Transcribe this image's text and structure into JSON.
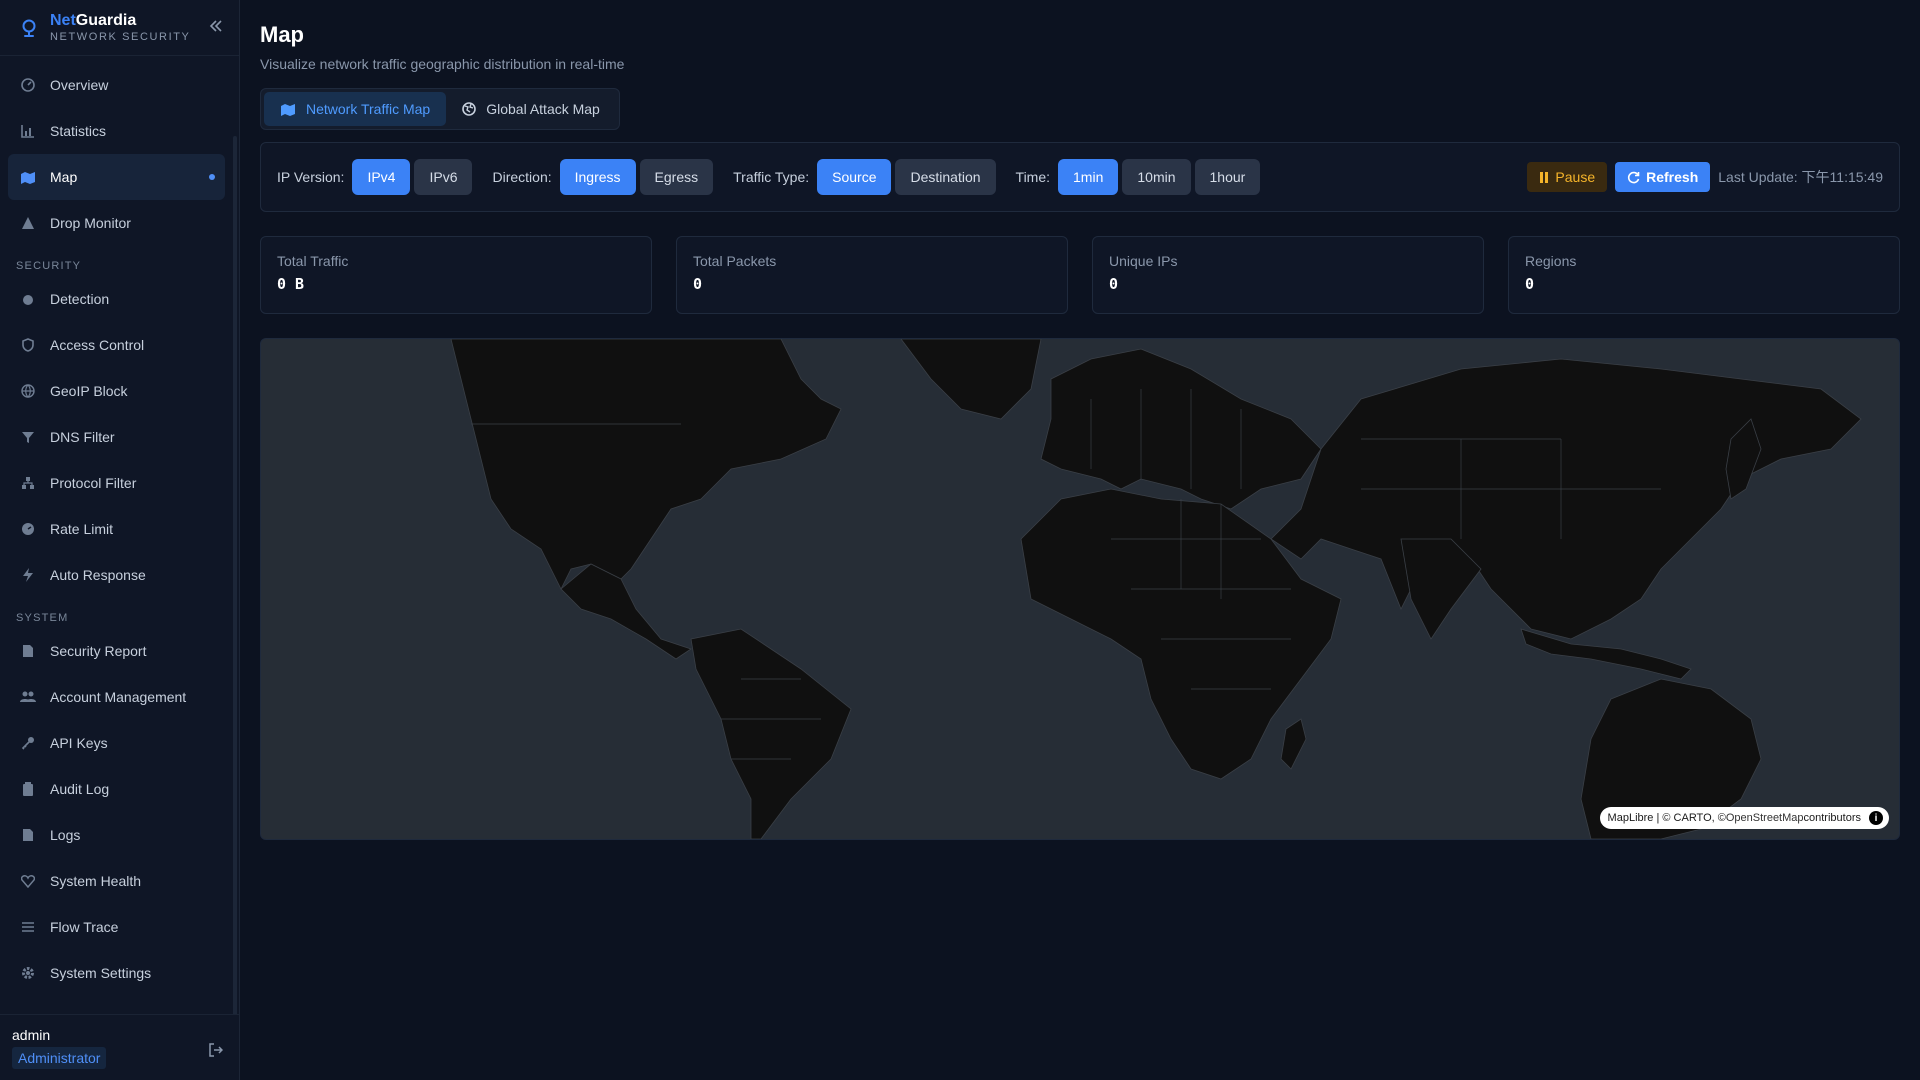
{
  "brand": {
    "name_part1": "Net",
    "name_part2": "Guardia",
    "subtitle": "NETWORK SECURITY"
  },
  "sidebar": {
    "main_items": [
      {
        "label": "Overview"
      },
      {
        "label": "Statistics"
      },
      {
        "label": "Map",
        "active": true
      },
      {
        "label": "Drop Monitor"
      }
    ],
    "security_label": "SECURITY",
    "security_items": [
      {
        "label": "Detection"
      },
      {
        "label": "Access Control"
      },
      {
        "label": "GeoIP Block"
      },
      {
        "label": "DNS Filter"
      },
      {
        "label": "Protocol Filter"
      },
      {
        "label": "Rate Limit"
      },
      {
        "label": "Auto Response"
      }
    ],
    "system_label": "SYSTEM",
    "system_items": [
      {
        "label": "Security Report"
      },
      {
        "label": "Account Management"
      },
      {
        "label": "API Keys"
      },
      {
        "label": "Audit Log"
      },
      {
        "label": "Logs"
      },
      {
        "label": "System Health"
      },
      {
        "label": "Flow Trace"
      },
      {
        "label": "System Settings"
      }
    ]
  },
  "user": {
    "name": "admin",
    "role": "Administrator"
  },
  "page": {
    "title": "Map",
    "subtitle": "Visualize network traffic geographic distribution in real-time",
    "tabs": [
      {
        "label": "Network Traffic Map",
        "active": true
      },
      {
        "label": "Global Attack Map",
        "active": false
      }
    ]
  },
  "filters": {
    "ip_version": {
      "label": "IP Version:",
      "options": [
        "IPv4",
        "IPv6"
      ],
      "selected": "IPv4"
    },
    "direction": {
      "label": "Direction:",
      "options": [
        "Ingress",
        "Egress"
      ],
      "selected": "Ingress"
    },
    "traffic_type": {
      "label": "Traffic Type:",
      "options": [
        "Source",
        "Destination"
      ],
      "selected": "Source"
    },
    "time": {
      "label": "Time:",
      "options": [
        "1min",
        "10min",
        "1hour"
      ],
      "selected": "1min"
    },
    "pause_label": "Pause",
    "refresh_label": "Refresh",
    "last_update": "Last Update: 下午11:15:49"
  },
  "stats": [
    {
      "label": "Total Traffic",
      "value": "0 B"
    },
    {
      "label": "Total Packets",
      "value": "0"
    },
    {
      "label": "Unique IPs",
      "value": "0"
    },
    {
      "label": "Regions",
      "value": "0"
    }
  ],
  "map": {
    "attribution_part1": "MapLibre | © CARTO, © ",
    "attribution_part2": "OpenStreetMap",
    "attribution_part3": " contributors",
    "ocean_color": "#262d36",
    "land_color": "#101010"
  },
  "colors": {
    "accent": "#3b82f6",
    "warning": "#f5b42a",
    "background": "#0c1220"
  }
}
